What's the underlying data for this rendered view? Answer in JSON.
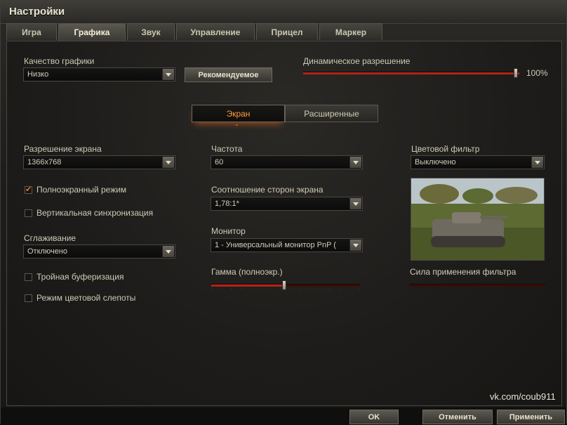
{
  "window": {
    "title": "Настройки"
  },
  "tabs": [
    {
      "label": "Игра",
      "active": false
    },
    {
      "label": "Графика",
      "active": true
    },
    {
      "label": "Звук",
      "active": false
    },
    {
      "label": "Управление",
      "active": false
    },
    {
      "label": "Прицел",
      "active": false
    },
    {
      "label": "Маркер",
      "active": false
    }
  ],
  "graphics_quality": {
    "label": "Качество графики",
    "value": "Низко"
  },
  "recommended_button": "Рекомендуемое",
  "dynamic_resolution": {
    "label": "Динамическое разрешение",
    "value_text": "100%",
    "value": 1.0
  },
  "subtabs": [
    {
      "label": "Экран",
      "active": true
    },
    {
      "label": "Расширенные",
      "active": false
    }
  ],
  "left": {
    "resolution": {
      "label": "Разрешение экрана",
      "value": "1366x768"
    },
    "fullscreen": {
      "label": "Полноэкранный режим",
      "checked": true
    },
    "vsync": {
      "label": "Вертикальная синхронизация",
      "checked": false
    },
    "antialiasing": {
      "label": "Сглаживание",
      "value": "Отключено"
    },
    "triple_buffering": {
      "label": "Тройная буферизация",
      "checked": false
    },
    "colorblind": {
      "label": "Режим цветовой слепоты",
      "checked": false
    }
  },
  "middle": {
    "frequency": {
      "label": "Частота",
      "value": "60"
    },
    "aspect": {
      "label": "Соотношение сторон экрана",
      "value": "1,78:1*"
    },
    "monitor": {
      "label": "Монитор",
      "value": "1 - Универсальный монитор PnP ("
    },
    "gamma": {
      "label": "Гамма (полноэкр.)",
      "value": 0.5
    }
  },
  "right": {
    "color_filter": {
      "label": "Цветовой фильтр",
      "value": "Выключено"
    },
    "filter_strength": {
      "label": "Сила применения фильтра",
      "value": 0
    }
  },
  "watermark": "vk.com/coub911",
  "buttons": {
    "ok": "OK",
    "cancel": "Отменить",
    "apply": "Применить"
  },
  "colors": {
    "accent_orange": "#ff9a3c",
    "slider_red": "#b32416",
    "panel_bg": "#1e1d1b"
  }
}
